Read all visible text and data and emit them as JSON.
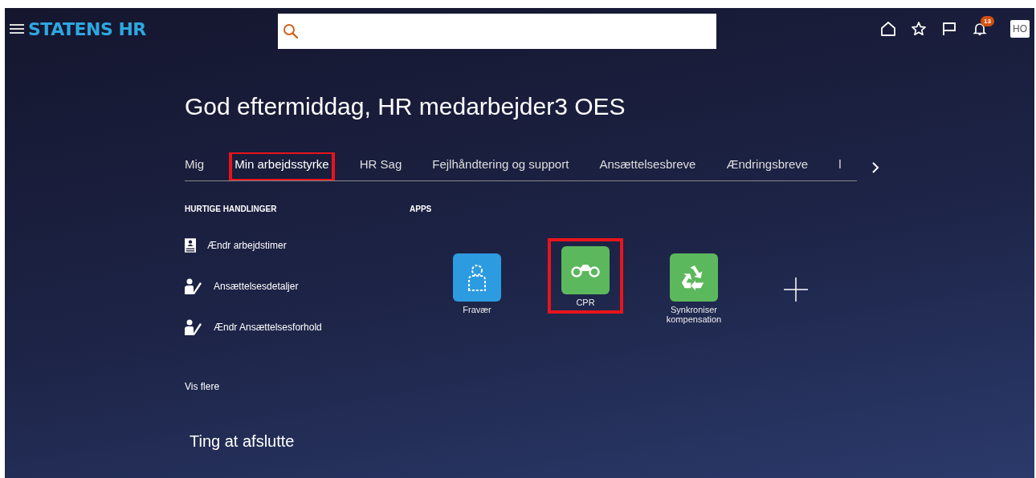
{
  "header": {
    "logo": "STATENS HR",
    "notification_count": "13",
    "avatar": "HO"
  },
  "greeting": "God eftermiddag, HR medarbejder3 OES",
  "tabs": [
    {
      "label": "Mig",
      "selected": false,
      "highlighted": false
    },
    {
      "label": "Min arbejdsstyrke",
      "selected": true,
      "highlighted": true
    },
    {
      "label": "HR Sag",
      "selected": false,
      "highlighted": false
    },
    {
      "label": "Fejlhåndtering og support",
      "selected": false,
      "highlighted": false
    },
    {
      "label": "Ansættelsesbreve",
      "selected": false,
      "highlighted": false
    },
    {
      "label": "Ændringsbreve",
      "selected": false,
      "highlighted": false
    },
    {
      "label": "l",
      "selected": false,
      "highlighted": false
    }
  ],
  "quick_actions": {
    "heading": "HURTIGE HANDLINGER",
    "items": [
      {
        "label": "Ændr arbejdstimer",
        "kind": "badge"
      },
      {
        "label": "Ansættelsesdetaljer",
        "kind": "person-edit"
      },
      {
        "label": "Ændr Ansættelsesforhold",
        "kind": "person-edit"
      }
    ],
    "more": "Vis flere"
  },
  "apps": {
    "heading": "APPS",
    "items": [
      {
        "label": "Fravær",
        "kind": "person",
        "color": "#2d9be0",
        "highlighted": false
      },
      {
        "label": "CPR",
        "kind": "binoculars",
        "color": "#5cb85c",
        "highlighted": true
      },
      {
        "label": "Synkroniser kompensation",
        "kind": "recycle",
        "color": "#5cb85c",
        "highlighted": false
      }
    ]
  },
  "things_to_finish": "Ting at afslutte"
}
